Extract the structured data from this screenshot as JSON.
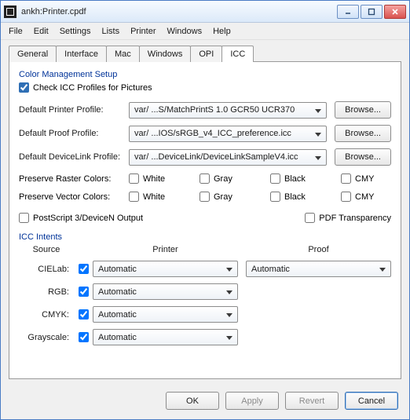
{
  "window": {
    "title": "ankh:Printer.cpdf"
  },
  "menu": {
    "file": "File",
    "edit": "Edit",
    "settings": "Settings",
    "lists": "Lists",
    "printer": "Printer",
    "windows": "Windows",
    "help": "Help"
  },
  "tabs": {
    "general": "General",
    "interface": "Interface",
    "mac": "Mac",
    "windows": "Windows",
    "opi": "OPI",
    "icc": "ICC"
  },
  "section": {
    "cms_label": "Color Management Setup",
    "check_icc": "Check ICC Profiles for Pictures",
    "default_printer": "Default Printer Profile:",
    "default_proof": "Default Proof Profile:",
    "default_devlink": "Default DeviceLink Profile:",
    "printer_val": "var/ ...S/MatchPrintS 1.0 GCR50 UCR370",
    "proof_val": "var/ ...IOS/sRGB_v4_ICC_preference.icc",
    "devlink_val": "var/ ...DeviceLink/DeviceLinkSampleV4.icc",
    "browse": "Browse...",
    "preserve_raster": "Preserve Raster Colors:",
    "preserve_vector": "Preserve Vector Colors:",
    "white": "White",
    "gray": "Gray",
    "black": "Black",
    "cmy": "CMY",
    "ps3": "PostScript 3/DeviceN Output",
    "pdftrans": "PDF Transparency",
    "icc_intents": "ICC Intents",
    "source": "Source",
    "printer_h": "Printer",
    "proof_h": "Proof",
    "cielab": "CIELab:",
    "rgb": "RGB:",
    "cmyk": "CMYK:",
    "grayscale": "Grayscale:",
    "automatic": "Automatic"
  },
  "footer": {
    "ok": "OK",
    "apply": "Apply",
    "revert": "Revert",
    "cancel": "Cancel"
  }
}
